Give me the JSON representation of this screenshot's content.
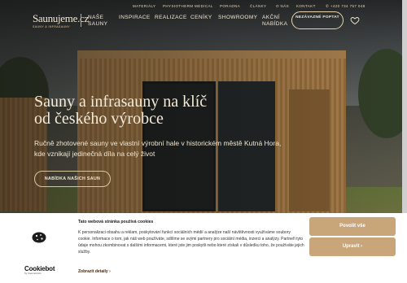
{
  "topbar": {
    "links": [
      "Materiály",
      "Physiotherm medical",
      "Poradna",
      "Články",
      "O nás",
      "Kontakt"
    ],
    "phone": "+420 734 757 048"
  },
  "logo": {
    "wordmark": "Saunujeme.cz",
    "tagline": "SAUNY & INFRASAUNY"
  },
  "mainnav": {
    "items": [
      "Naše sauny",
      "Inspirace",
      "Realizace",
      "Ceníky",
      "Showroomy",
      "Akční nabídka"
    ]
  },
  "cta_top": "NEZÁVAZNÉ POPTAT",
  "hero": {
    "title_line1": "Sauny a infrasauny na klíč",
    "title_line2": "od českého výrobce",
    "subtitle": "Ručně zhotovené sauny ve vlastní výrobní hale v historickém městě Kutná Hora, kde vznikají jedinečná díla na celý život",
    "button": "Nabídka našich saun"
  },
  "cookie": {
    "title": "Tato webová stránka používá cookies",
    "text": "K personalizaci obsahu a reklam, poskytování funkcí sociálních médií a analýze naší návštěvnosti využíváme soubory cookie. Informace o tom, jak náš web používáte, sdílíme se svými partnery pro sociální média, inzerci a analýzy. Partneři tyto údaje mohou zkombinovat s dalšími informacemi, které jste jim poskytli nebo které získali v důsledku toho, že používáte jejich služby.",
    "more": "Zobrazit detaily",
    "allow": "Povolit vše",
    "adjust": "Upravit",
    "brand": "Cookiebot",
    "brand_sub": "by Usercentrics"
  },
  "colors": {
    "accent": "#c9a57a",
    "nav_text": "#f3ead9"
  }
}
